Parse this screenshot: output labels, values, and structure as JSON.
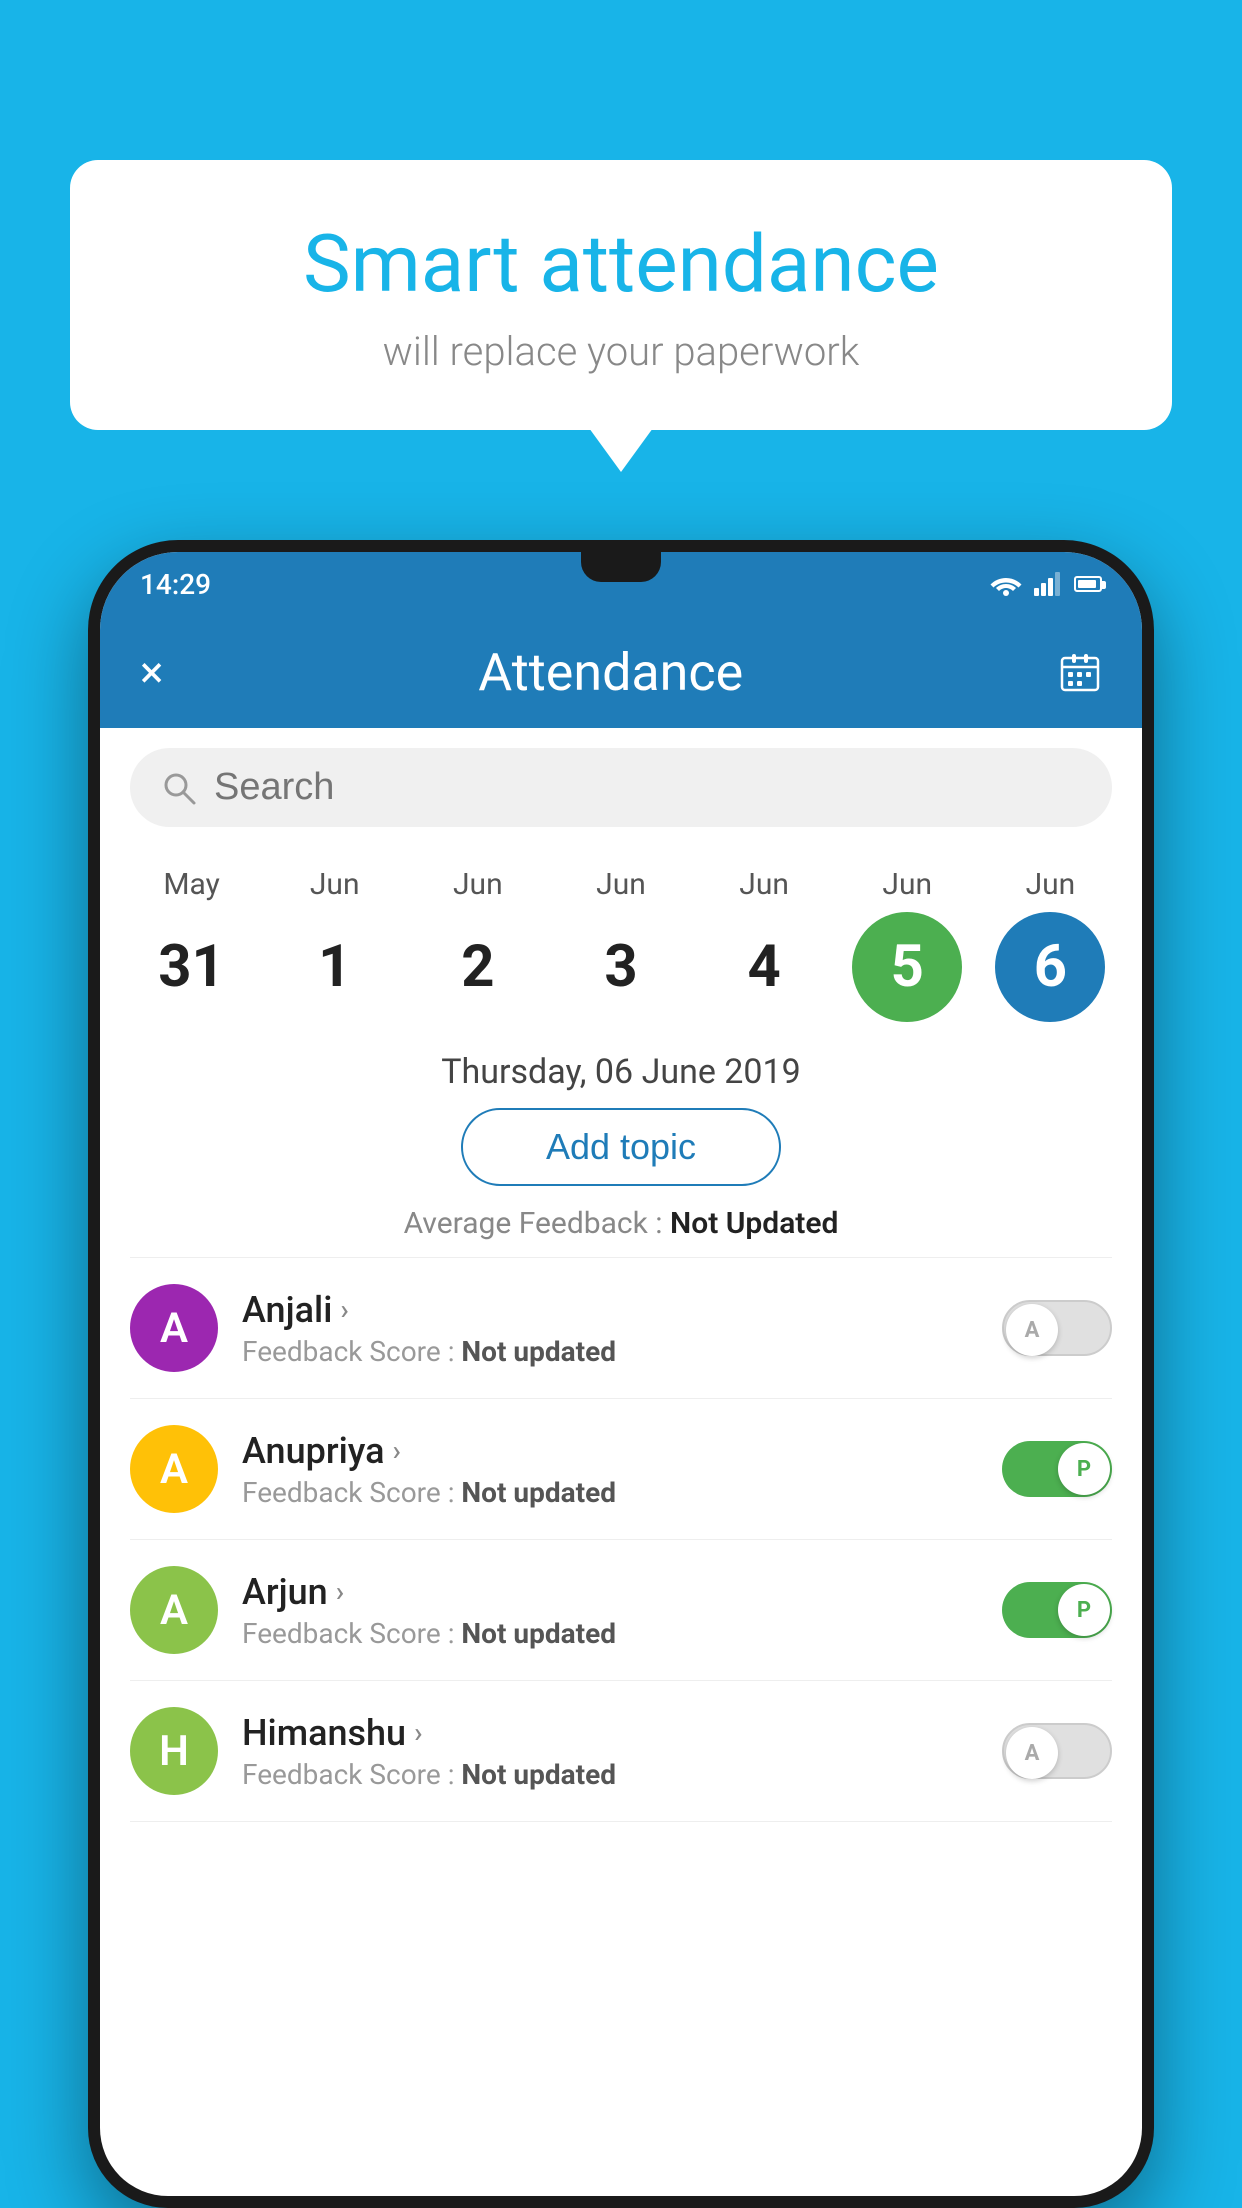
{
  "background_color": "#18b4e8",
  "bubble": {
    "title": "Smart attendance",
    "subtitle": "will replace your paperwork"
  },
  "status_bar": {
    "time": "14:29",
    "icons": [
      "wifi",
      "signal",
      "battery"
    ]
  },
  "app_bar": {
    "title": "Attendance",
    "close_label": "×",
    "calendar_icon": "calendar"
  },
  "search": {
    "placeholder": "Search"
  },
  "calendar": {
    "days": [
      {
        "month": "May",
        "number": "31",
        "selected": ""
      },
      {
        "month": "Jun",
        "number": "1",
        "selected": ""
      },
      {
        "month": "Jun",
        "number": "2",
        "selected": ""
      },
      {
        "month": "Jun",
        "number": "3",
        "selected": ""
      },
      {
        "month": "Jun",
        "number": "4",
        "selected": ""
      },
      {
        "month": "Jun",
        "number": "5",
        "selected": "green"
      },
      {
        "month": "Jun",
        "number": "6",
        "selected": "blue"
      }
    ],
    "selected_date": "Thursday, 06 June 2019"
  },
  "add_topic": {
    "label": "Add topic"
  },
  "feedback_avg": {
    "label": "Average Feedback : ",
    "value": "Not Updated"
  },
  "students": [
    {
      "name": "Anjali",
      "avatar_letter": "A",
      "avatar_color": "#9c27b0",
      "feedback_label": "Feedback Score : ",
      "feedback_value": "Not updated",
      "toggle_state": "off",
      "toggle_letter": "A"
    },
    {
      "name": "Anupriya",
      "avatar_letter": "A",
      "avatar_color": "#ffc107",
      "feedback_label": "Feedback Score : ",
      "feedback_value": "Not updated",
      "toggle_state": "on",
      "toggle_letter": "P"
    },
    {
      "name": "Arjun",
      "avatar_letter": "A",
      "avatar_color": "#8bc34a",
      "feedback_label": "Feedback Score : ",
      "feedback_value": "Not updated",
      "toggle_state": "on",
      "toggle_letter": "P"
    },
    {
      "name": "Himanshu",
      "avatar_letter": "H",
      "avatar_color": "#8bc34a",
      "feedback_label": "Feedback Score : ",
      "feedback_value": "Not updated",
      "toggle_state": "off",
      "toggle_letter": "A"
    }
  ]
}
